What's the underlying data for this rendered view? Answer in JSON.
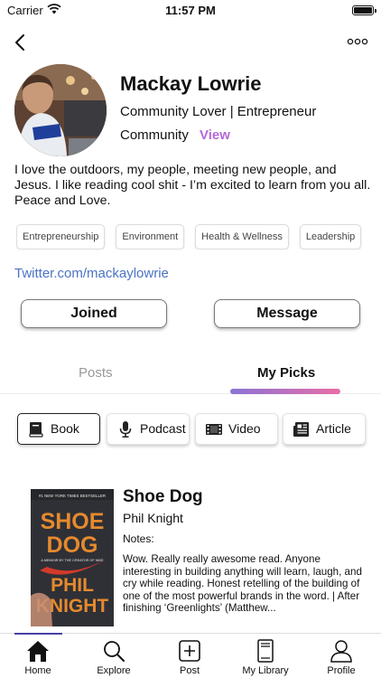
{
  "status_bar": {
    "carrier": "Carrier",
    "time": "11:57 PM"
  },
  "profile": {
    "name": "Mackay Lowrie",
    "tagline": "Community Lover | Entrepreneur",
    "community_label": "Community",
    "view_label": "View",
    "bio": "I love the outdoors, my people, meeting new people, and Jesus. I like reading cool shit - I’m excited to learn from you all. Peace and Love.",
    "interests": [
      "Entrepreneurship",
      "Environment",
      "Health & Wellness",
      "Leadership"
    ],
    "twitter": "Twitter.com/mackaylowrie"
  },
  "actions": {
    "joined": "Joined",
    "message": "Message"
  },
  "tabs": {
    "posts": "Posts",
    "my_picks": "My Picks",
    "selected": "My Picks"
  },
  "types": [
    {
      "label": "Book",
      "icon": "book-icon",
      "selected": true
    },
    {
      "label": "Podcast",
      "icon": "microphone-icon",
      "selected": false
    },
    {
      "label": "Video",
      "icon": "film-icon",
      "selected": false
    },
    {
      "label": "Article",
      "icon": "newspaper-icon",
      "selected": false
    }
  ],
  "pick": {
    "title": "Shoe Dog",
    "author": "Phil Knight",
    "notes_label": "Notes:",
    "notes": "Wow. Really really awesome read. Anyone interesting in building anything will learn, laugh, and cry while reading. Honest retelling of the building of one of the most powerful brands in the word. | After finishing ‘Greenlights’ (Matthew...",
    "cover": {
      "banner": "#1 NEW YORK TIMES BESTSELLER",
      "title_line1": "SHOE",
      "title_line2": "DOG",
      "subtitle": "A MEMOIR BY THE CREATOR OF NIKE",
      "author_line1": "PHIL",
      "author_line2": "KNIGHT"
    }
  },
  "tabbar": [
    {
      "label": "Home",
      "icon": "home-icon",
      "active": true
    },
    {
      "label": "Explore",
      "icon": "search-icon",
      "active": false
    },
    {
      "label": "Post",
      "icon": "add-post-icon",
      "active": false
    },
    {
      "label": "My Library",
      "icon": "library-icon",
      "active": false
    },
    {
      "label": "Profile",
      "icon": "profile-icon",
      "active": false
    }
  ],
  "colors": {
    "accent_view": "#b46ad7",
    "link": "#4a73c4",
    "tab_gradient_start": "#8a74d6",
    "tab_gradient_end": "#e96ea6",
    "cover_orange": "#e58a2e"
  }
}
